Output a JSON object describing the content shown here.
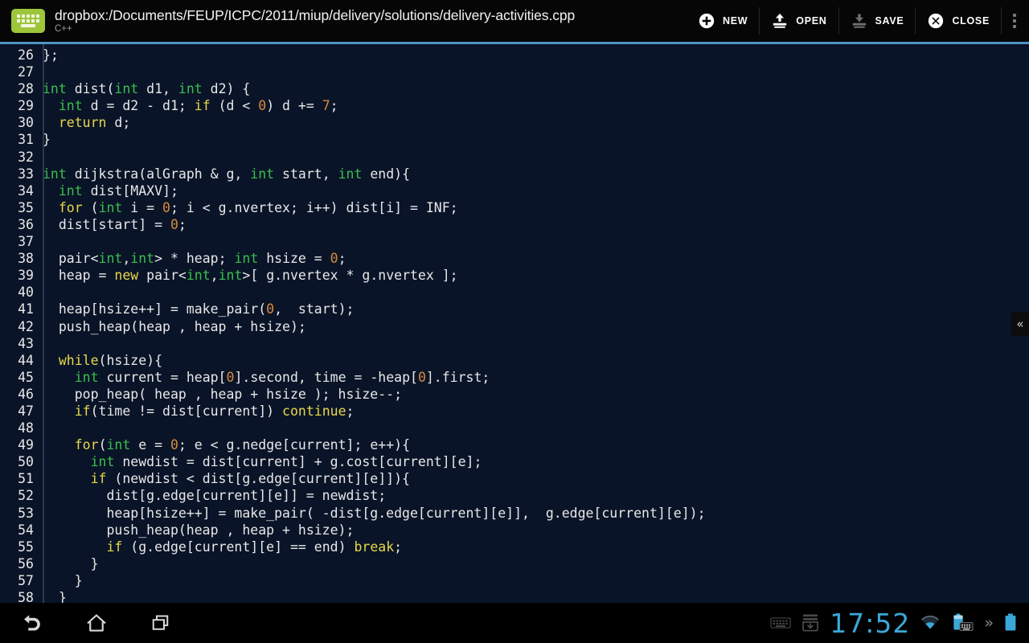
{
  "header": {
    "app_icon": "keyboard-icon",
    "document_path": "dropbox:/Documents/FEUP/ICPC/2011/miup/delivery/solutions/delivery-activities.cpp",
    "language": "C++",
    "actions": [
      {
        "id": "new",
        "label": "NEW",
        "icon": "plus-circle-icon",
        "enabled": true
      },
      {
        "id": "open",
        "label": "OPEN",
        "icon": "open-tray-icon",
        "enabled": true
      },
      {
        "id": "save",
        "label": "SAVE",
        "icon": "save-tray-icon",
        "enabled": false
      },
      {
        "id": "close",
        "label": "CLOSE",
        "icon": "close-circle-icon",
        "enabled": true
      }
    ],
    "overflow_label": "overflow-menu"
  },
  "colors": {
    "accent_line": "#4e93c8",
    "editor_bg": "#0a1428",
    "header_bg": "#060606",
    "keyword": "#e8d84a",
    "type": "#3bbf4e",
    "number": "#d98a3a",
    "text": "#e8e8e8",
    "app_icon": "#9ec63b",
    "clock": "#3aa8d8"
  },
  "editor": {
    "first_visible_line": 26,
    "last_visible_line": 58,
    "drawer_tab_glyph": "«",
    "lines": [
      {
        "n": 26,
        "tokens": [
          {
            "t": "};",
            "c": "p"
          }
        ]
      },
      {
        "n": 27,
        "tokens": []
      },
      {
        "n": 28,
        "tokens": [
          {
            "t": "int",
            "c": "typ"
          },
          {
            "t": " dist(",
            "c": "p"
          },
          {
            "t": "int",
            "c": "typ"
          },
          {
            "t": " d1, ",
            "c": "p"
          },
          {
            "t": "int",
            "c": "typ"
          },
          {
            "t": " d2) {",
            "c": "p"
          }
        ]
      },
      {
        "n": 29,
        "tokens": [
          {
            "t": "  ",
            "c": "p"
          },
          {
            "t": "int",
            "c": "typ"
          },
          {
            "t": " d = d2 - d1; ",
            "c": "p"
          },
          {
            "t": "if",
            "c": "kw"
          },
          {
            "t": " (d < ",
            "c": "p"
          },
          {
            "t": "0",
            "c": "num"
          },
          {
            "t": ") d += ",
            "c": "p"
          },
          {
            "t": "7",
            "c": "num"
          },
          {
            "t": ";",
            "c": "p"
          }
        ]
      },
      {
        "n": 30,
        "tokens": [
          {
            "t": "  ",
            "c": "p"
          },
          {
            "t": "return",
            "c": "kw"
          },
          {
            "t": " d;",
            "c": "p"
          }
        ]
      },
      {
        "n": 31,
        "tokens": [
          {
            "t": "}",
            "c": "p"
          }
        ]
      },
      {
        "n": 32,
        "tokens": []
      },
      {
        "n": 33,
        "tokens": [
          {
            "t": "int",
            "c": "typ"
          },
          {
            "t": " dijkstra(alGraph & g, ",
            "c": "p"
          },
          {
            "t": "int",
            "c": "typ"
          },
          {
            "t": " start, ",
            "c": "p"
          },
          {
            "t": "int",
            "c": "typ"
          },
          {
            "t": " end){",
            "c": "p"
          }
        ]
      },
      {
        "n": 34,
        "tokens": [
          {
            "t": "  ",
            "c": "p"
          },
          {
            "t": "int",
            "c": "typ"
          },
          {
            "t": " dist[MAXV];",
            "c": "p"
          }
        ]
      },
      {
        "n": 35,
        "tokens": [
          {
            "t": "  ",
            "c": "p"
          },
          {
            "t": "for",
            "c": "kw"
          },
          {
            "t": " (",
            "c": "p"
          },
          {
            "t": "int",
            "c": "typ"
          },
          {
            "t": " i = ",
            "c": "p"
          },
          {
            "t": "0",
            "c": "num"
          },
          {
            "t": "; i < g.nvertex; i++) dist[i] = INF;",
            "c": "p"
          }
        ]
      },
      {
        "n": 36,
        "tokens": [
          {
            "t": "  dist[start] = ",
            "c": "p"
          },
          {
            "t": "0",
            "c": "num"
          },
          {
            "t": ";",
            "c": "p"
          }
        ]
      },
      {
        "n": 37,
        "tokens": []
      },
      {
        "n": 38,
        "tokens": [
          {
            "t": "  pair<",
            "c": "p"
          },
          {
            "t": "int",
            "c": "typ"
          },
          {
            "t": ",",
            "c": "p"
          },
          {
            "t": "int",
            "c": "typ"
          },
          {
            "t": "> * heap; ",
            "c": "p"
          },
          {
            "t": "int",
            "c": "typ"
          },
          {
            "t": " hsize = ",
            "c": "p"
          },
          {
            "t": "0",
            "c": "num"
          },
          {
            "t": ";",
            "c": "p"
          }
        ]
      },
      {
        "n": 39,
        "tokens": [
          {
            "t": "  heap = ",
            "c": "p"
          },
          {
            "t": "new",
            "c": "kw"
          },
          {
            "t": " pair<",
            "c": "p"
          },
          {
            "t": "int",
            "c": "typ"
          },
          {
            "t": ",",
            "c": "p"
          },
          {
            "t": "int",
            "c": "typ"
          },
          {
            "t": ">[ g.nvertex * g.nvertex ];",
            "c": "p"
          }
        ]
      },
      {
        "n": 40,
        "tokens": []
      },
      {
        "n": 41,
        "tokens": [
          {
            "t": "  heap[hsize++] = make_pair(",
            "c": "p"
          },
          {
            "t": "0",
            "c": "num"
          },
          {
            "t": ",  start);",
            "c": "p"
          }
        ]
      },
      {
        "n": 42,
        "tokens": [
          {
            "t": "  push_heap(heap , heap + hsize);",
            "c": "p"
          }
        ]
      },
      {
        "n": 43,
        "tokens": []
      },
      {
        "n": 44,
        "tokens": [
          {
            "t": "  ",
            "c": "p"
          },
          {
            "t": "while",
            "c": "kw"
          },
          {
            "t": "(hsize){",
            "c": "p"
          }
        ]
      },
      {
        "n": 45,
        "tokens": [
          {
            "t": "    ",
            "c": "p"
          },
          {
            "t": "int",
            "c": "typ"
          },
          {
            "t": " current = heap[",
            "c": "p"
          },
          {
            "t": "0",
            "c": "num"
          },
          {
            "t": "].second, time = -heap[",
            "c": "p"
          },
          {
            "t": "0",
            "c": "num"
          },
          {
            "t": "].first;",
            "c": "p"
          }
        ]
      },
      {
        "n": 46,
        "tokens": [
          {
            "t": "    pop_heap( heap , heap + hsize ); hsize--;",
            "c": "p"
          }
        ]
      },
      {
        "n": 47,
        "tokens": [
          {
            "t": "    ",
            "c": "p"
          },
          {
            "t": "if",
            "c": "kw"
          },
          {
            "t": "(time != dist[current]) ",
            "c": "p"
          },
          {
            "t": "continue",
            "c": "kw"
          },
          {
            "t": ";",
            "c": "p"
          }
        ]
      },
      {
        "n": 48,
        "tokens": []
      },
      {
        "n": 49,
        "tokens": [
          {
            "t": "    ",
            "c": "p"
          },
          {
            "t": "for",
            "c": "kw"
          },
          {
            "t": "(",
            "c": "p"
          },
          {
            "t": "int",
            "c": "typ"
          },
          {
            "t": " e = ",
            "c": "p"
          },
          {
            "t": "0",
            "c": "num"
          },
          {
            "t": "; e < g.nedge[current]; e++){",
            "c": "p"
          }
        ]
      },
      {
        "n": 50,
        "tokens": [
          {
            "t": "      ",
            "c": "p"
          },
          {
            "t": "int",
            "c": "typ"
          },
          {
            "t": " newdist = dist[current] + g.cost[current][e];",
            "c": "p"
          }
        ]
      },
      {
        "n": 51,
        "tokens": [
          {
            "t": "      ",
            "c": "p"
          },
          {
            "t": "if",
            "c": "kw"
          },
          {
            "t": " (newdist < dist[g.edge[current][e]]){",
            "c": "p"
          }
        ]
      },
      {
        "n": 52,
        "tokens": [
          {
            "t": "        dist[g.edge[current][e]] = newdist;",
            "c": "p"
          }
        ]
      },
      {
        "n": 53,
        "tokens": [
          {
            "t": "        heap[hsize++] = make_pair( -dist[g.edge[current][e]],  g.edge[current][e]);",
            "c": "p"
          }
        ]
      },
      {
        "n": 54,
        "tokens": [
          {
            "t": "        push_heap(heap , heap + hsize);",
            "c": "p"
          }
        ]
      },
      {
        "n": 55,
        "tokens": [
          {
            "t": "        ",
            "c": "p"
          },
          {
            "t": "if",
            "c": "kw"
          },
          {
            "t": " (g.edge[current][e] == end) ",
            "c": "p"
          },
          {
            "t": "break",
            "c": "kw"
          },
          {
            "t": ";",
            "c": "p"
          }
        ]
      },
      {
        "n": 56,
        "tokens": [
          {
            "t": "      }",
            "c": "p"
          }
        ]
      },
      {
        "n": 57,
        "tokens": [
          {
            "t": "    }",
            "c": "p"
          }
        ]
      },
      {
        "n": 58,
        "tokens": [
          {
            "t": "  }",
            "c": "p"
          }
        ]
      }
    ]
  },
  "system_bar": {
    "nav": [
      {
        "id": "back",
        "icon": "back-arrow-icon"
      },
      {
        "id": "home",
        "icon": "home-icon"
      },
      {
        "id": "recent",
        "icon": "recent-apps-icon"
      }
    ],
    "status": {
      "keyboard_icon": "keyboard-icon",
      "download_icon": "download-tray-icon",
      "time": "17:52",
      "wifi_icon": "wifi-icon",
      "keyboard_battery_icon": "keyboard-battery-icon",
      "expand_glyph": "»",
      "battery_icon": "battery-icon"
    }
  }
}
